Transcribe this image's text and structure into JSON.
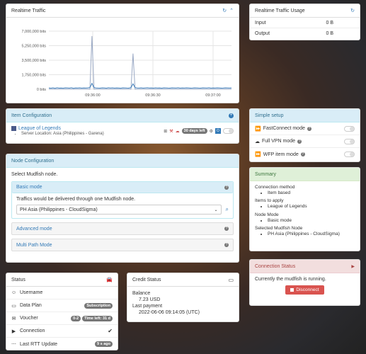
{
  "realtime_traffic": {
    "title": "Realtime Traffic",
    "refresh_icon": "refresh-icon",
    "collapse_icon": "chevron-up-icon"
  },
  "chart_data": {
    "type": "line",
    "yticks": [
      "7,000,000 bits",
      "5,250,000 bits",
      "3,500,000 bits",
      "1,750,000 bits",
      "0 bits"
    ],
    "xticks": [
      "09:36:00",
      "09:36:30",
      "09:37:00"
    ],
    "ylim": [
      0,
      7000000
    ],
    "series": [
      {
        "values": [
          0,
          0,
          0,
          0,
          0,
          0,
          0,
          0,
          0,
          0,
          0,
          0,
          0,
          0,
          0,
          0,
          0,
          0,
          0,
          0,
          0,
          6400000,
          0,
          0,
          0,
          0,
          0,
          0,
          0,
          0,
          0,
          0,
          0,
          0,
          0,
          0,
          0,
          0,
          0,
          0,
          0,
          4300000,
          0,
          0,
          0,
          0,
          0,
          0,
          0,
          0,
          0,
          0,
          0,
          0,
          0,
          0,
          0,
          0,
          0,
          0,
          0,
          0,
          0,
          0,
          0,
          0,
          0,
          0,
          0,
          0,
          0,
          0,
          0,
          0,
          0,
          0,
          0,
          0,
          0,
          0,
          0,
          0,
          0,
          0,
          0,
          0,
          0,
          0,
          0,
          0
        ],
        "color": "#99a8c4"
      },
      {
        "values": [
          150000,
          120000,
          160000,
          110000,
          170000,
          130000,
          140000,
          120000,
          160000,
          150000,
          130000,
          170000,
          110000,
          150000,
          140000,
          160000,
          130000,
          150000,
          140000,
          160000,
          200000,
          700000,
          200000,
          150000,
          140000,
          130000,
          160000,
          150000,
          120000,
          170000,
          140000,
          160000,
          130000,
          150000,
          140000,
          120000,
          160000,
          150000,
          140000,
          130000,
          200000,
          650000,
          200000,
          150000,
          140000,
          160000,
          130000,
          150000,
          170000,
          140000,
          150000,
          130000,
          160000,
          140000,
          150000,
          120000,
          160000,
          150000,
          140000,
          130000,
          160000,
          150000,
          140000,
          170000,
          130000,
          150000,
          140000,
          160000,
          150000,
          130000,
          140000,
          160000,
          150000,
          140000,
          130000,
          160000,
          150000,
          140000,
          170000,
          130000,
          150000,
          140000,
          160000,
          150000,
          130000,
          140000,
          160000,
          150000,
          140000,
          150000
        ],
        "color": "#3a7ab8"
      }
    ]
  },
  "traffic_usage": {
    "title": "Realtime Traffic Usage",
    "rows": [
      {
        "label": "Input",
        "value": "0 B"
      },
      {
        "label": "Output",
        "value": "0 B"
      }
    ]
  },
  "item_config": {
    "title": "Item Configuration",
    "game_name": "League of Legends",
    "server_location": "Server Location: Asia (Philippines - Garena)",
    "days_left": "30 days left",
    "toggle_label": "O"
  },
  "simple_setup": {
    "title": "Simple setup",
    "items": [
      {
        "label": "FastConnect mode"
      },
      {
        "label": "Full VPN mode"
      },
      {
        "label": "WFP item mode"
      }
    ]
  },
  "node_config": {
    "title": "Node Configuration",
    "intro": "Select Mudfish node.",
    "basic_mode_title": "Basic mode",
    "basic_mode_desc": "Traffics would be delivered through one Mudfish node.",
    "selected_node": "PH Asia (Philippines - CloudSigma)",
    "advanced_mode_title": "Advanced mode",
    "multipath_mode_title": "Multi Path Mode"
  },
  "summary": {
    "title": "Summary",
    "sections": [
      {
        "heading": "Connection method",
        "items": [
          "Item based"
        ]
      },
      {
        "heading": "Items to apply",
        "items": [
          "League of Legends"
        ]
      },
      {
        "heading": "Node Mode",
        "items": [
          "Basic mode"
        ]
      },
      {
        "heading": "Selected Mudfish Node",
        "items": [
          "PH Asia (Philippines - CloudSigma)"
        ]
      }
    ]
  },
  "connection_status": {
    "title": "Connection Status",
    "message": "Currently the mudfish is running.",
    "disconnect_label": "Disconnect"
  },
  "status": {
    "title": "Status",
    "rows": [
      {
        "label": "Username",
        "badge": ""
      },
      {
        "label": "Data Plan",
        "badge": "Subscription"
      },
      {
        "label": "Voucher",
        "badge": "0-2",
        "badge2": "Time left: 31 d"
      },
      {
        "label": "Connection",
        "badge": ""
      },
      {
        "label": "Last RTT Update",
        "badge": "9 s ago"
      }
    ]
  },
  "credit_status": {
    "title": "Credit Status",
    "balance_label": "Balance",
    "balance_value": "7.23 USD",
    "last_payment_label": "Last payment",
    "last_payment_value": "2022-06-06 09:14:05 (UTC)"
  }
}
